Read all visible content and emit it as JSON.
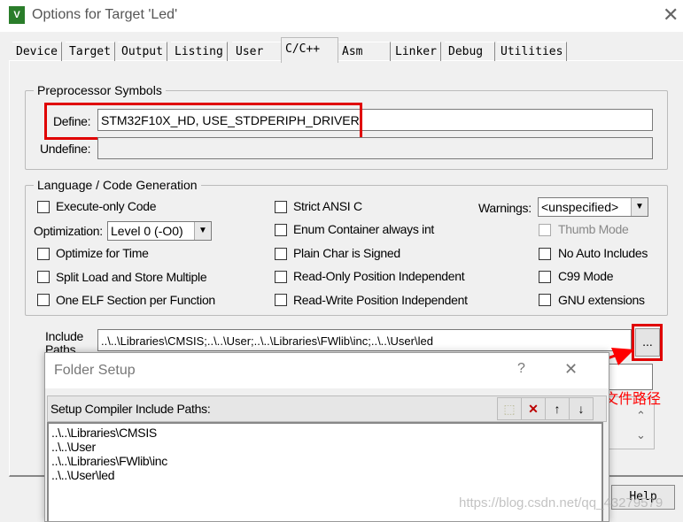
{
  "window": {
    "title": "Options for Target 'Led'",
    "close": "✕",
    "icon": "keil-uvision-icon"
  },
  "tabs": [
    "Device",
    "Target",
    "Output",
    "Listing",
    "User",
    "C/C++",
    "Asm",
    "Linker",
    "Debug",
    "Utilities"
  ],
  "active_tab": "C/C++",
  "preprocessor": {
    "group_label": "Preprocessor Symbols",
    "define_label": "Define:",
    "define_value": "STM32F10X_HD, USE_STDPERIPH_DRIVER",
    "undefine_label": "Undefine:",
    "undefine_value": ""
  },
  "language": {
    "group_label": "Language / Code Generation",
    "execute_only": "Execute-only Code",
    "optimization_label": "Optimization:",
    "optimization_value": "Level 0 (-O0)",
    "optimize_time": "Optimize for Time",
    "split_load": "Split Load and Store Multiple",
    "one_elf": "One ELF Section per Function",
    "strict_ansi": "Strict ANSI C",
    "enum_container": "Enum Container always int",
    "plain_char": "Plain Char is Signed",
    "ro_pi": "Read-Only Position Independent",
    "rw_pi": "Read-Write Position Independent",
    "warnings_label": "Warnings:",
    "warnings_value": "<unspecified>",
    "thumb_mode": "Thumb Mode",
    "no_auto_includes": "No Auto Includes",
    "c99": "C99 Mode",
    "gnu": "GNU extensions"
  },
  "include": {
    "label_line1": "Include",
    "label_line2": "Paths",
    "value": "..\\..\\Libraries\\CMSIS;..\\..\\User;..\\..\\Libraries\\FWlib\\inc;..\\..\\User\\led",
    "browse": "..."
  },
  "help_button": "Help",
  "folder_setup": {
    "title": "Folder Setup",
    "help": "?",
    "close": "✕",
    "header": "Setup Compiler Include Paths:",
    "paths": [
      "..\\..\\Libraries\\CMSIS",
      "..\\..\\User",
      "..\\..\\Libraries\\FWlib\\inc",
      "..\\..\\User\\led"
    ]
  },
  "annotation": {
    "text": "添加对应的头文件路径",
    "color": "#ff0000"
  },
  "watermark": "https://blog.csdn.net/qq_43279579"
}
